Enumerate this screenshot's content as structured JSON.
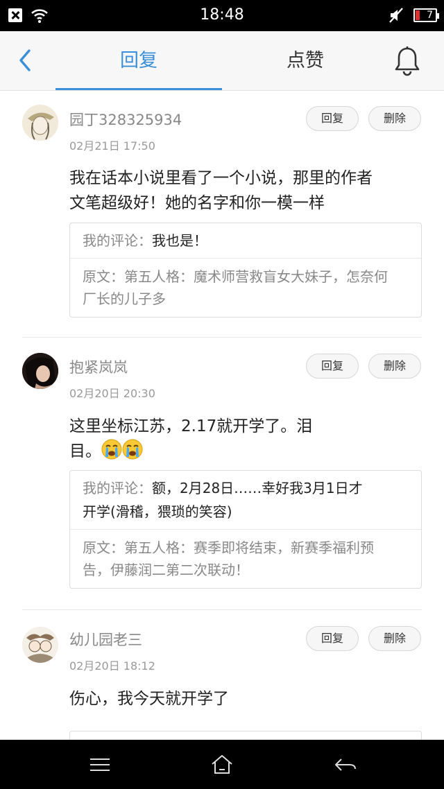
{
  "status_bar": {
    "time": "18:48",
    "battery": "7"
  },
  "header": {
    "tabs": [
      {
        "label": "回复",
        "active": true
      },
      {
        "label": "点赞",
        "active": false
      }
    ],
    "accent_color": "#3a8fd8"
  },
  "comments": [
    {
      "username": "园丁328325934",
      "timestamp": "02月21日 17:50",
      "reply_label": "回复",
      "delete_label": "删除",
      "body_lines": [
        "我在话本小说里看了一个小说，那里的作者",
        "文笔超级好！她的名字和你一模一样"
      ],
      "my_comment_label": "我的评论：",
      "my_comment_lines": [
        "我也是！"
      ],
      "original_lines": [
        "原文：第五人格：魔术师营救盲女大妹子，怎奈何",
        "厂长的儿子多"
      ]
    },
    {
      "username": "抱紧岚岚",
      "timestamp": "02月20日 20:30",
      "reply_label": "回复",
      "delete_label": "删除",
      "body_lines": [
        "这里坐标江苏，2.17就开学了。泪",
        "目。"
      ],
      "my_comment_label": "我的评论：",
      "my_comment_lines": [
        "额，2月28日……幸好我3月1日才",
        "开学(滑稽，猥琐的笑容)"
      ],
      "original_lines": [
        "原文：第五人格：赛季即将结束，新赛季福利预",
        "告，伊藤润二第二次联动！"
      ]
    },
    {
      "username": "幼儿园老三",
      "timestamp": "02月20日 18:12",
      "reply_label": "回复",
      "delete_label": "删除",
      "body_lines": [
        "伤心，我今天就开学了"
      ]
    }
  ]
}
